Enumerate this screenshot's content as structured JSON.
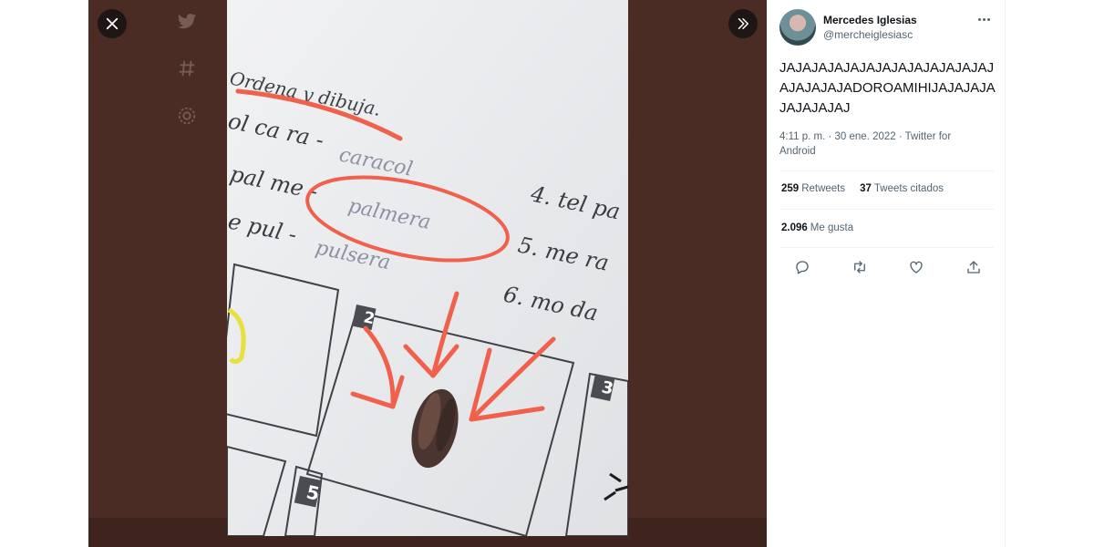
{
  "viewer": {
    "close_icon": "close-icon",
    "expand_icon": "chevron-double-right-icon",
    "ghost_nav": [
      "twitter-bird-icon",
      "hashtag-icon",
      "settings-icon"
    ]
  },
  "worksheet": {
    "title": "Ordena y dibuja.",
    "rows": [
      {
        "prompt": "ol ca ra -",
        "answer": "caracol"
      },
      {
        "prompt": "pal me -",
        "answer": "palmera"
      },
      {
        "prompt": "e pul -",
        "answer": "pulsera"
      }
    ],
    "right_rows": [
      "4. tel pa",
      "5. me ra",
      "6. mo da"
    ],
    "box_numbers": [
      "2",
      "3",
      "5"
    ],
    "colors": {
      "annotation": "#f0604a",
      "paper": "#e9eaec"
    }
  },
  "tweet": {
    "author": {
      "name": "Mercedes Iglesias",
      "handle": "@mercheiglesiasc"
    },
    "text": "JAJAJAJAJAJAJAJAJAJAJAJAJAJAJAJAJAJADOROAMIHIJAJAJAJAJAJAJAJAJ",
    "meta": "4:11 p. m. · 30 ene. 2022 · Twitter for Android",
    "retweets": {
      "count": "259",
      "label": "Retweets"
    },
    "quotes": {
      "count": "37",
      "label": "Tweets citados"
    },
    "likes": {
      "count": "2.096",
      "label": "Me gusta"
    },
    "actions": [
      "reply-icon",
      "retweet-icon",
      "like-icon",
      "share-icon"
    ]
  }
}
